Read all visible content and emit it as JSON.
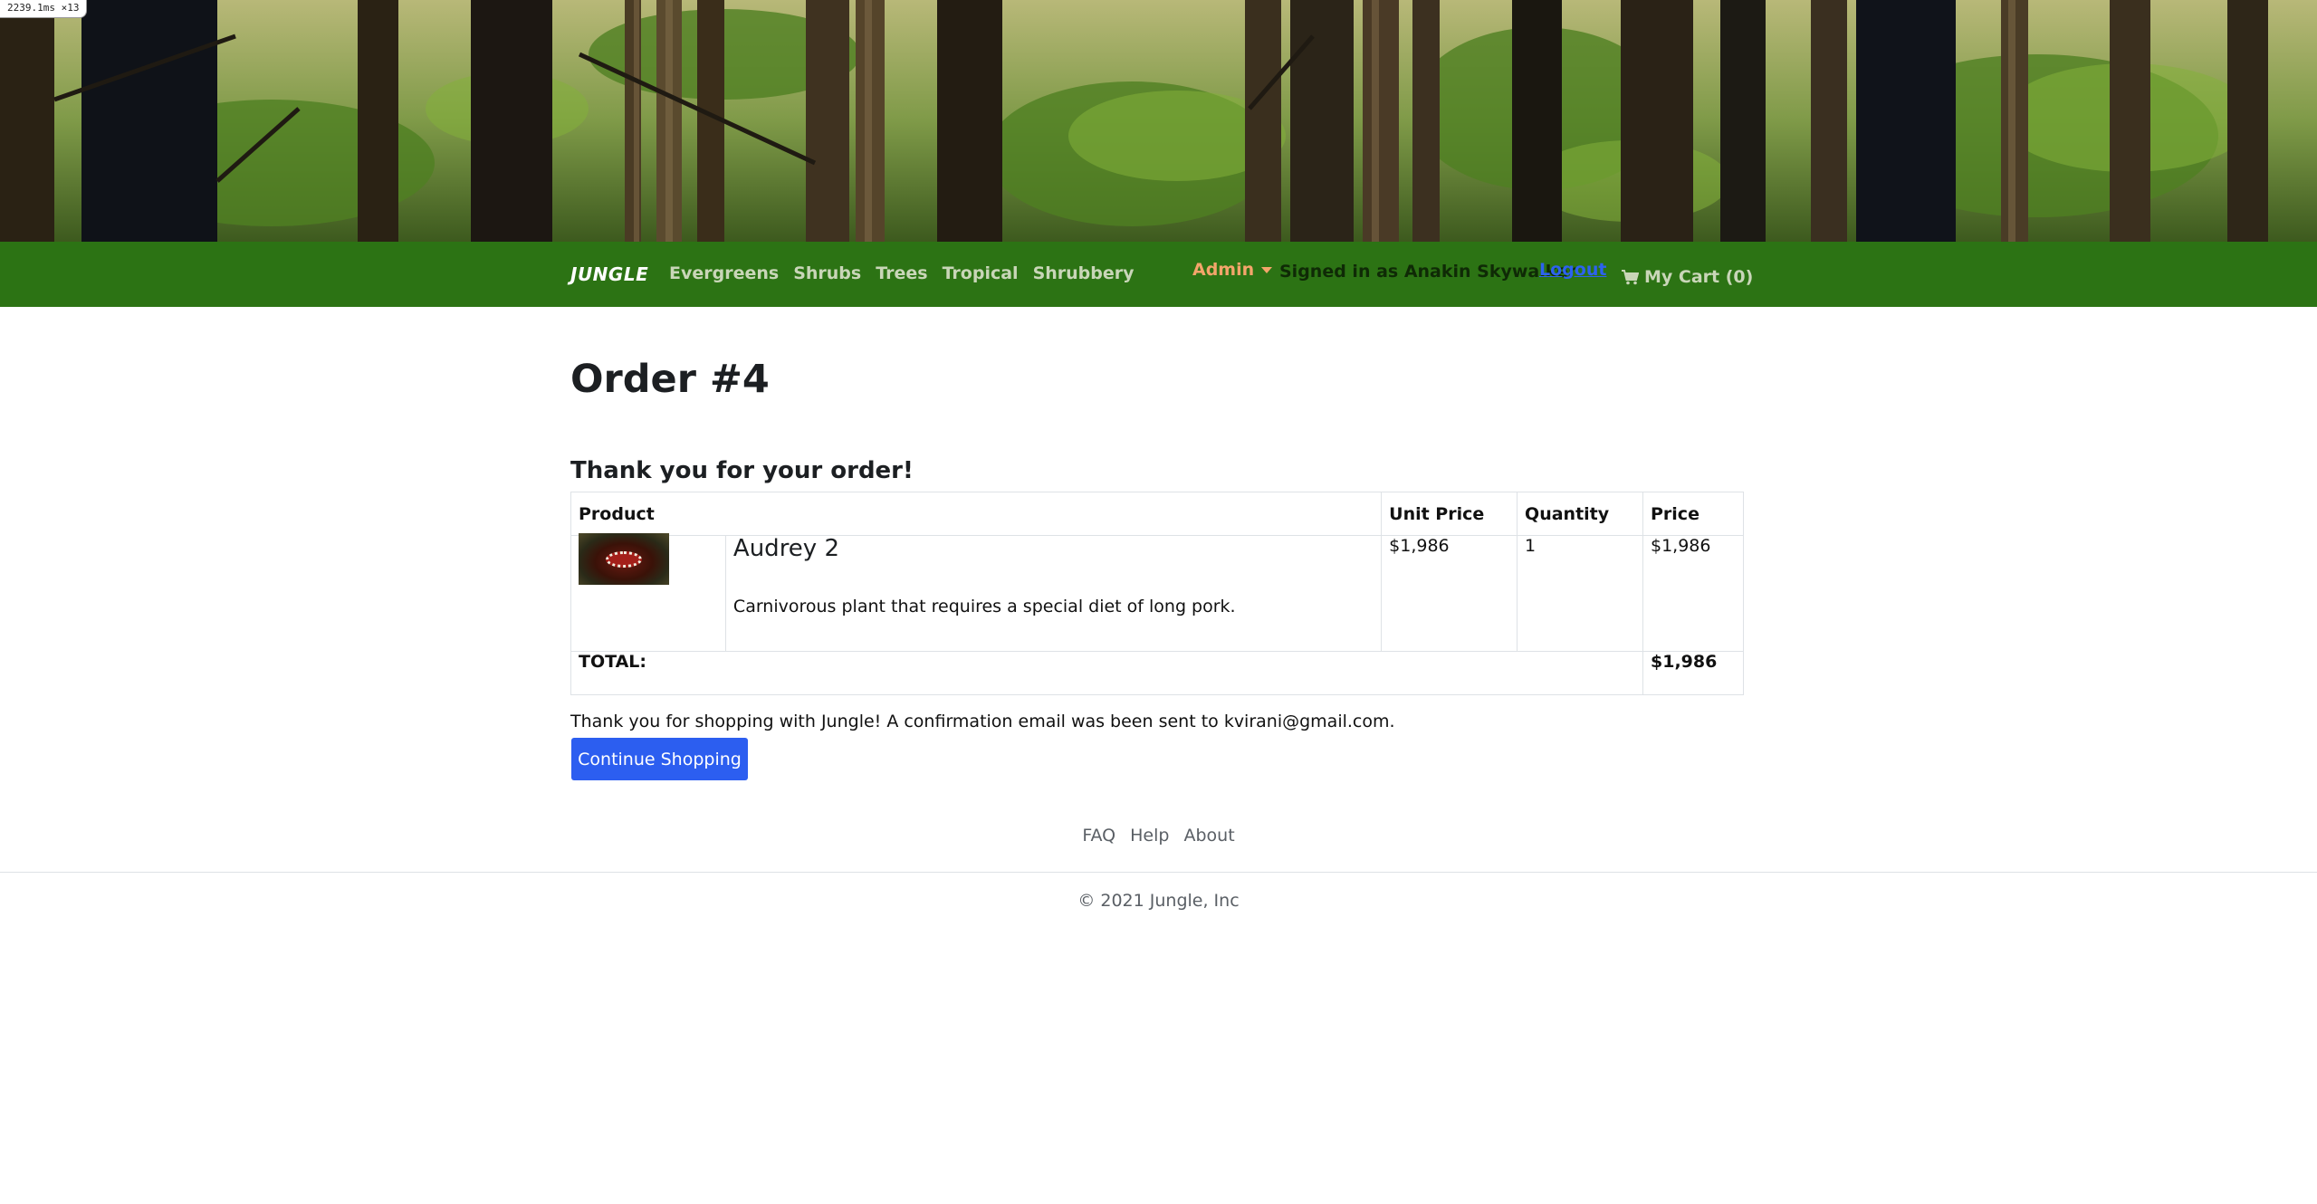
{
  "perf_badge": "2239.1ms ×13",
  "navbar": {
    "brand": "JUNGLE",
    "categories": [
      "Evergreens",
      "Shrubs",
      "Trees",
      "Tropical",
      "Shrubbery"
    ],
    "admin_label": "Admin",
    "signed_in_text": "Signed in as Anakin Skywalker",
    "logout_label": "Logout",
    "cart_label": "My Cart (0)",
    "cart_icon": "shopping-cart-icon",
    "colors": {
      "bar": "#2c7314",
      "admin": "#f4a56b",
      "logout": "#2d62f0"
    }
  },
  "order": {
    "title": "Order #4",
    "thanks_heading": "Thank you for your order!",
    "table": {
      "headers": {
        "product": "Product",
        "unit_price": "Unit Price",
        "quantity": "Quantity",
        "price": "Price"
      },
      "items": [
        {
          "name": "Audrey 2",
          "description": "Carnivorous plant that requires a special diet of long pork.",
          "unit_price": "$1,986",
          "quantity": "1",
          "price": "$1,986"
        }
      ],
      "total_label": "TOTAL:",
      "total_value": "$1,986"
    },
    "confirmation_text": "Thank you for shopping with Jungle! A confirmation email was been sent to kvirani@gmail.com.",
    "continue_button": "Continue Shopping",
    "button_color": "#2c5ef0"
  },
  "footer": {
    "links": [
      "FAQ",
      "Help",
      "About"
    ],
    "copyright": "© 2021 Jungle, Inc"
  }
}
